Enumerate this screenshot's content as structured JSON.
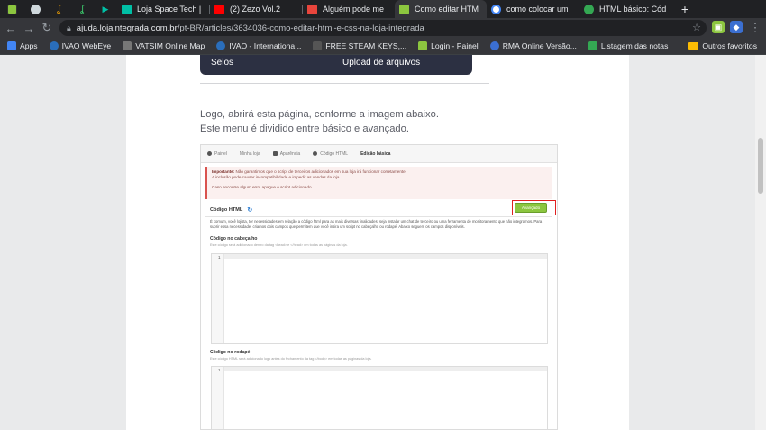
{
  "tabs": [
    {
      "title": "Loja Space Tech | ",
      "color": "#00bfa5"
    },
    {
      "title": "(2) Zezo Vol.2",
      "color": "#ff0000"
    },
    {
      "title": "Alguém pode me",
      "color": "#e8453c"
    },
    {
      "title": "Como editar HTM",
      "color": "#8cc63f",
      "active": true
    },
    {
      "title": "como colocar um",
      "color": "#4285f4"
    },
    {
      "title": "HTML básico: Cód",
      "color": "#34a853"
    }
  ],
  "toolbar": {
    "url_host": "ajuda.lojaintegrada.com.br",
    "url_path": "/pt-BR/articles/3634036-como-editar-html-e-css-na-loja-integrada"
  },
  "bookmarks": [
    {
      "label": "Apps",
      "color": "#4285f4"
    },
    {
      "label": "IVAO WebEye",
      "color": "#2a6ebb"
    },
    {
      "label": "VATSIM Online Map",
      "color": "#777777"
    },
    {
      "label": "IVAO - Internationa...",
      "color": "#2a6ebb"
    },
    {
      "label": "FREE STEAM KEYS,...",
      "color": "#555555"
    },
    {
      "label": "Login - Painel",
      "color": "#8cc63f"
    },
    {
      "label": "RMA Online Versão...",
      "color": "#3b6fd1"
    },
    {
      "label": "Listagem das notas",
      "color": "#34a853"
    }
  ],
  "bookmarks_other": "Outros favoritos",
  "article": {
    "card_col1": "Selos",
    "card_col2": "Upload de arquivos",
    "para_line1": "Logo, abrirá esta página, conforme a imagem abaixo.",
    "para_line2": "Este menu é dividido entre básico e avançado."
  },
  "shot": {
    "crumbs": [
      "Painel",
      "Minha loja",
      "Aparência",
      "Código HTML",
      "Edição básica"
    ],
    "alert_strong": "Importante:",
    "alert_text": " Não garantimos que o script de terceiros adicionados em sua loja irá funcionar corretamente.",
    "alert_line2": "A inclusão pode causar incompatibilidade e impedir as vendas da loja.",
    "alert_line3": "Caso encontre algum erro, apague o script adicionado.",
    "heading": "Código HTML",
    "advanced_button": "Avançado",
    "intro": "É comum, você lojista, ter necessidades em relação a código html para as mais diversas finalidades, seja instalar um chat de terceiro ou uma ferramenta de monitoramento que não integramos. Para suprir essa necessidade, criamos dois campos que permitem que você insira um script no cabeçalho ou rodapé. Abaixo seguem os campos disponíveis.",
    "header_title": "Código no cabeçalho",
    "header_hint": "Este código será adicionado dentro da tag <head> e </head> em todas as páginas da loja.",
    "footer_title": "Código no rodapé",
    "footer_hint": "Este código HTML será adicionado logo antes do fechamento da tag </body> em todas as páginas da loja.",
    "line_number": "1"
  }
}
